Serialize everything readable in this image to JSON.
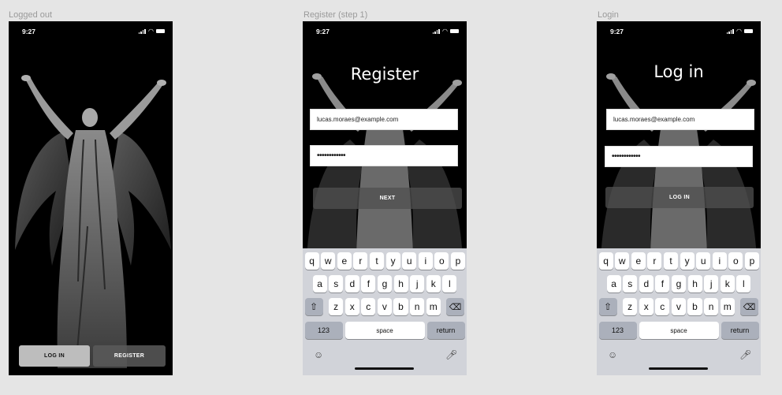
{
  "frames": {
    "logged_out": {
      "label": "Logged out"
    },
    "register": {
      "label": "Register (step 1)"
    },
    "login": {
      "label": "Login"
    }
  },
  "status": {
    "time": "9:27"
  },
  "logged_out": {
    "login_button": "LOG IN",
    "register_button": "REGISTER"
  },
  "register": {
    "title": "Register",
    "email_value": "lucas.moraes@example.com",
    "password_value": "••••••••••••",
    "next_button": "NEXT"
  },
  "login": {
    "title": "Log in",
    "email_value": "lucas.moraes@example.com",
    "password_value": "••••••••••••",
    "login_button": "LOG IN"
  },
  "keyboard": {
    "row1": [
      "q",
      "w",
      "e",
      "r",
      "t",
      "y",
      "u",
      "i",
      "o",
      "p"
    ],
    "row2": [
      "a",
      "s",
      "d",
      "f",
      "g",
      "h",
      "j",
      "k",
      "l"
    ],
    "row3": [
      "z",
      "x",
      "c",
      "v",
      "b",
      "n",
      "m"
    ],
    "shift_icon": "shift-icon",
    "backspace_icon": "backspace-icon",
    "numbers_label": "123",
    "space_label": "space",
    "return_label": "return",
    "emoji_icon": "emoji-icon",
    "mic_icon": "microphone-icon"
  },
  "colors": {
    "canvas": "#e5e5e5",
    "phone_bg": "#000000",
    "keyboard_bg": "#d1d3d9",
    "dark_button": "#505050"
  }
}
